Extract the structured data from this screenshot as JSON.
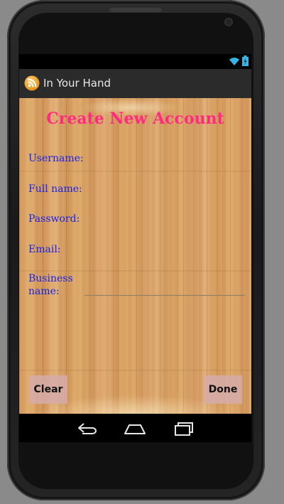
{
  "app": {
    "title": "In Your Hand"
  },
  "form": {
    "title": "Create New Account",
    "fields": [
      {
        "label": "Username:",
        "value": ""
      },
      {
        "label": "Full name:",
        "value": ""
      },
      {
        "label": "Password:",
        "value": ""
      },
      {
        "label": "Email:",
        "value": ""
      },
      {
        "label": "Business name:",
        "value": ""
      }
    ]
  },
  "buttons": {
    "clear_label": "Clear",
    "done_label": "Done"
  },
  "icons": {
    "status": [
      "wifi-icon",
      "battery-icon"
    ],
    "app": "rss-icon",
    "navigation": [
      "back-icon",
      "home-icon",
      "recents-icon"
    ]
  },
  "colors": {
    "title": "#ff2b80",
    "label": "#1a24e6",
    "action_bar": "#2b2b2b",
    "button_bg": "#d6acaa",
    "status_icon": "#33b5e5"
  }
}
